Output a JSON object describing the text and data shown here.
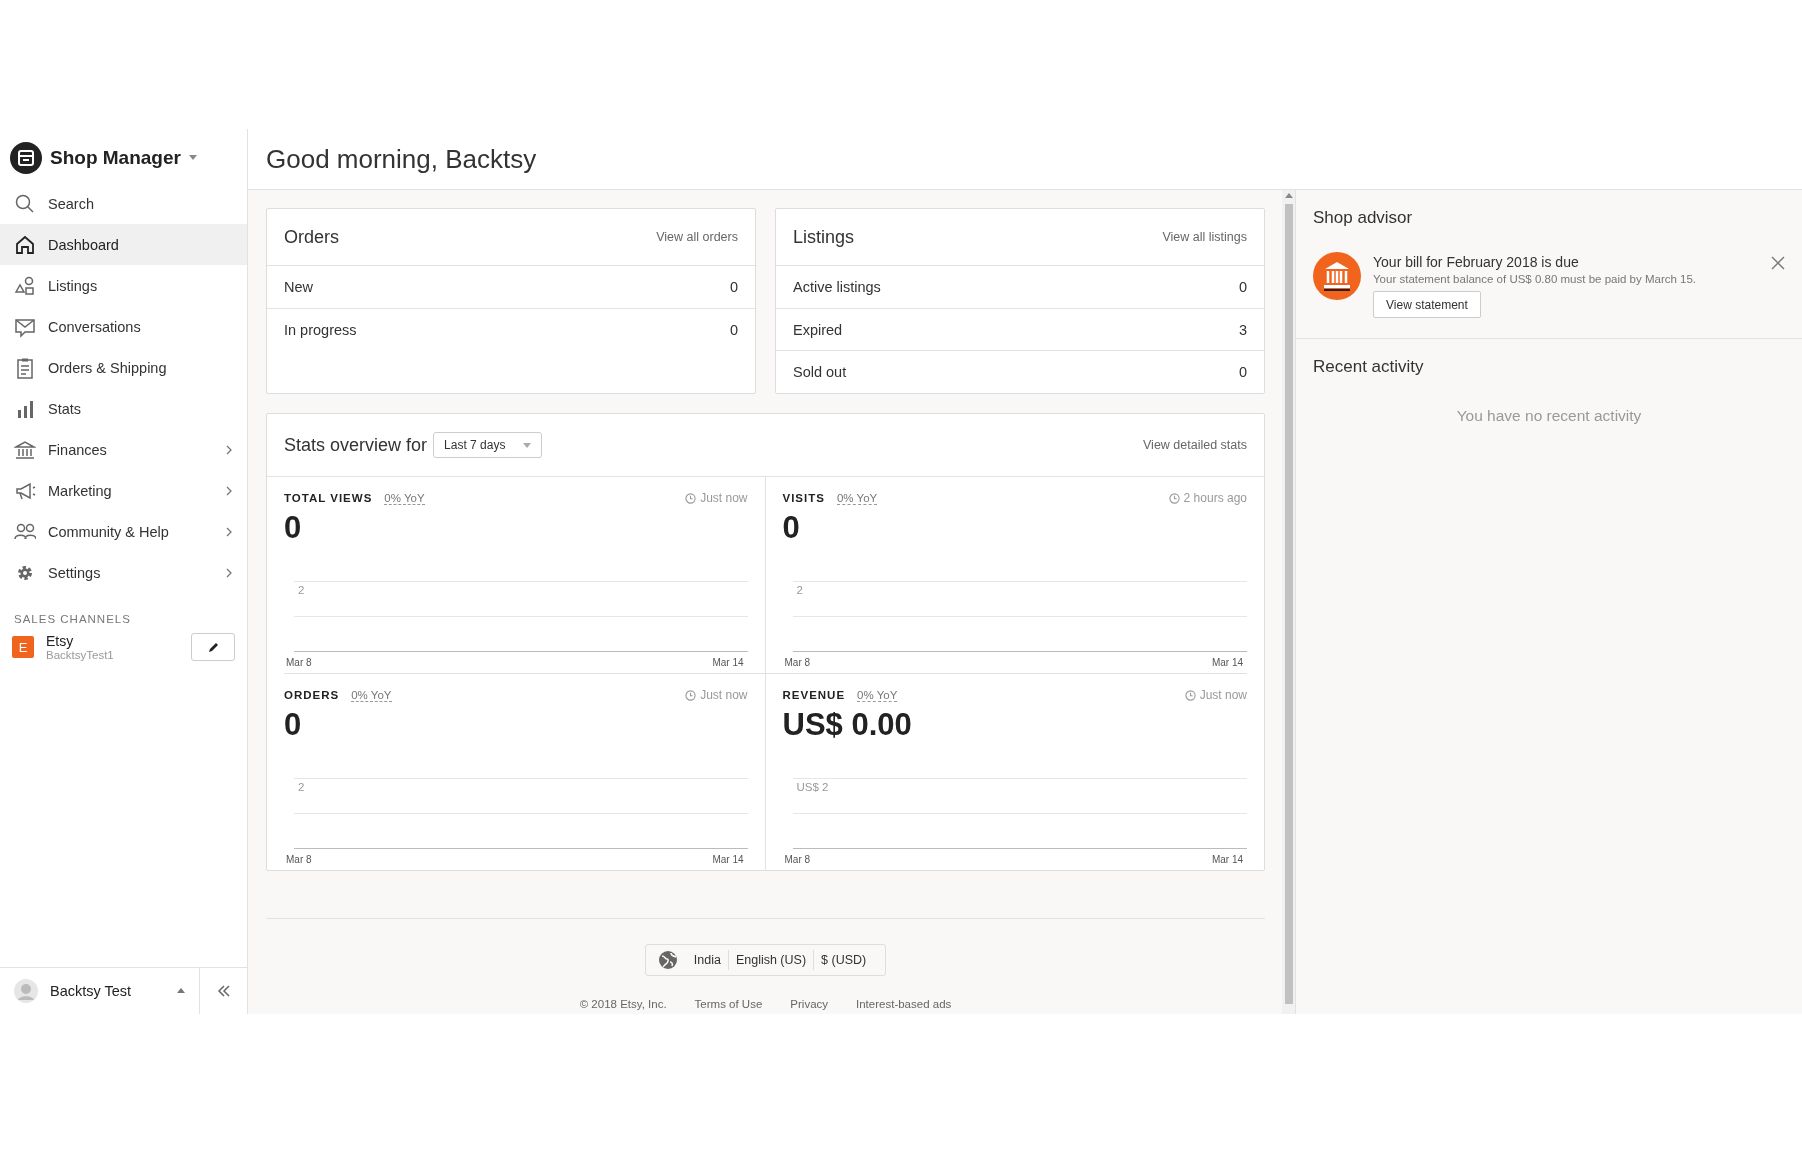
{
  "sidebar": {
    "title": "Shop Manager",
    "items": [
      {
        "label": "Search",
        "selected": false,
        "has_submenu": false
      },
      {
        "label": "Dashboard",
        "selected": true,
        "has_submenu": false
      },
      {
        "label": "Listings",
        "selected": false,
        "has_submenu": false
      },
      {
        "label": "Conversations",
        "selected": false,
        "has_submenu": false
      },
      {
        "label": "Orders & Shipping",
        "selected": false,
        "has_submenu": false
      },
      {
        "label": "Stats",
        "selected": false,
        "has_submenu": false
      },
      {
        "label": "Finances",
        "selected": false,
        "has_submenu": true
      },
      {
        "label": "Marketing",
        "selected": false,
        "has_submenu": true
      },
      {
        "label": "Community & Help",
        "selected": false,
        "has_submenu": true
      },
      {
        "label": "Settings",
        "selected": false,
        "has_submenu": true
      }
    ],
    "section_title": "SALES CHANNELS",
    "channel": {
      "badge": "E",
      "name": "Etsy",
      "shop": "BacktsyTest1"
    },
    "user": {
      "name": "Backtsy Test"
    }
  },
  "header": {
    "title": "Good morning, Backtsy"
  },
  "orders": {
    "title": "Orders",
    "link": "View all orders",
    "rows": [
      {
        "label": "New",
        "value": "0"
      },
      {
        "label": "In progress",
        "value": "0"
      }
    ]
  },
  "listings": {
    "title": "Listings",
    "link": "View all listings",
    "rows": [
      {
        "label": "Active listings",
        "value": "0"
      },
      {
        "label": "Expired",
        "value": "3"
      },
      {
        "label": "Sold out",
        "value": "0"
      }
    ]
  },
  "stats": {
    "title": "Stats overview for",
    "period": "Last 7 days",
    "link": "View detailed stats",
    "metrics": [
      {
        "label": "TOTAL VIEWS",
        "yoy": "0% YoY",
        "updated": "Just now",
        "value": "0",
        "y_tick": "2",
        "x_start": "Mar 8",
        "x_end": "Mar 14"
      },
      {
        "label": "VISITS",
        "yoy": "0% YoY",
        "updated": "2 hours ago",
        "value": "0",
        "y_tick": "2",
        "x_start": "Mar 8",
        "x_end": "Mar 14"
      },
      {
        "label": "ORDERS",
        "yoy": "0% YoY",
        "updated": "Just now",
        "value": "0",
        "y_tick": "2",
        "x_start": "Mar 8",
        "x_end": "Mar 14"
      },
      {
        "label": "REVENUE",
        "yoy": "0% YoY",
        "updated": "Just now",
        "value": "US$ 0.00",
        "y_tick": "US$ 2",
        "x_start": "Mar 8",
        "x_end": "Mar 14"
      }
    ]
  },
  "footer": {
    "region": "India",
    "language": "English (US)",
    "currency": "$ (USD)",
    "links": [
      "© 2018 Etsy, Inc.",
      "Terms of Use",
      "Privacy",
      "Interest-based ads"
    ]
  },
  "advisor": {
    "title": "Shop advisor",
    "alert_title": "Your bill for February 2018 is due",
    "alert_text": "Your statement balance of US$ 0.80 must be paid by March 15.",
    "button": "View statement"
  },
  "activity": {
    "title": "Recent activity",
    "empty": "You have no recent activity"
  }
}
